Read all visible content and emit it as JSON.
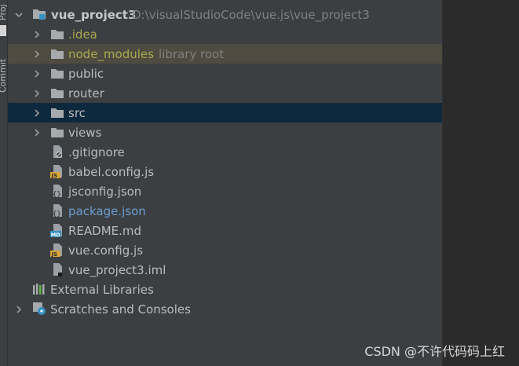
{
  "side_tabs": {
    "commit_label": "Commit"
  },
  "project": {
    "name": "vue_project3",
    "path": "D:\\visualStudioCode\\vue.js\\vue_project3"
  },
  "folders": [
    {
      "label": ".idea",
      "note": ""
    },
    {
      "label": "node_modules",
      "note": "library root"
    },
    {
      "label": "public",
      "note": ""
    },
    {
      "label": "router",
      "note": ""
    },
    {
      "label": "src",
      "note": ""
    },
    {
      "label": "views",
      "note": ""
    }
  ],
  "files": [
    {
      "label": ".gitignore",
      "icon": "gitignore-file-icon"
    },
    {
      "label": "babel.config.js",
      "icon": "js-file-icon"
    },
    {
      "label": "jsconfig.json",
      "icon": "json-file-icon"
    },
    {
      "label": "package.json",
      "icon": "json-file-icon"
    },
    {
      "label": "README.md",
      "icon": "markdown-file-icon"
    },
    {
      "label": "vue.config.js",
      "icon": "js-file-icon"
    },
    {
      "label": "vue_project3.iml",
      "icon": "iml-file-icon"
    }
  ],
  "external_libraries": {
    "label": "External Libraries"
  },
  "scratches": {
    "label": "Scratches and Consoles"
  },
  "watermark": "CSDN @不许代码码上红",
  "colors": {
    "panel_bg": "#3c3f41",
    "selected_bg": "#0d293e",
    "highlight_bg": "#4f4b41",
    "excluded_text": "#a9a950",
    "modified_text": "#6b9ed1",
    "folder_icon": "#a7aaad"
  }
}
